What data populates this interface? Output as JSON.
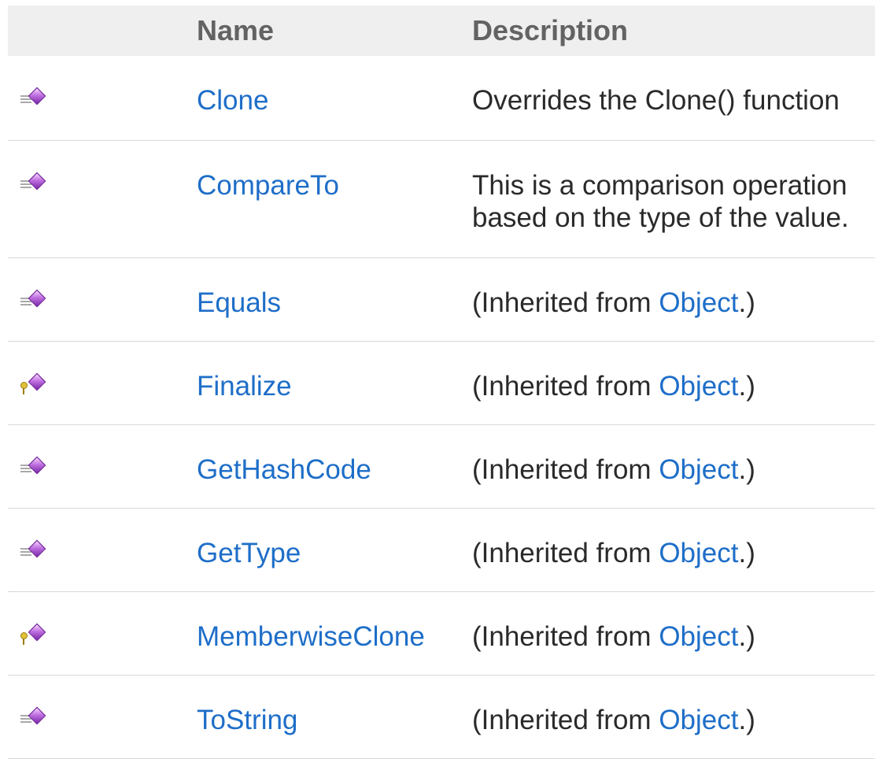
{
  "table": {
    "headers": {
      "icon": "",
      "name": "Name",
      "description": "Description"
    },
    "rows": [
      {
        "icon": "public-method-icon",
        "name": "Clone",
        "description": "Overrides the Clone() function"
      },
      {
        "icon": "public-method-icon",
        "name": "CompareTo",
        "description": "This is a comparison operation based on the type of the value."
      },
      {
        "icon": "public-method-icon",
        "name": "Equals",
        "inherited_prefix": "(Inherited from ",
        "inherited_link": "Object",
        "inherited_suffix": ".)"
      },
      {
        "icon": "protected-method-icon",
        "name": "Finalize",
        "inherited_prefix": "(Inherited from ",
        "inherited_link": "Object",
        "inherited_suffix": ".)"
      },
      {
        "icon": "public-method-icon",
        "name": "GetHashCode",
        "inherited_prefix": "(Inherited from ",
        "inherited_link": "Object",
        "inherited_suffix": ".)"
      },
      {
        "icon": "public-method-icon",
        "name": "GetType",
        "inherited_prefix": "(Inherited from ",
        "inherited_link": "Object",
        "inherited_suffix": ".)"
      },
      {
        "icon": "protected-method-icon",
        "name": "MemberwiseClone",
        "inherited_prefix": "(Inherited from ",
        "inherited_link": "Object",
        "inherited_suffix": ".)"
      },
      {
        "icon": "public-method-icon",
        "name": "ToString",
        "inherited_prefix": "(Inherited from ",
        "inherited_link": "Object",
        "inherited_suffix": ".)"
      }
    ]
  },
  "colors": {
    "link": "#1e6ec8",
    "header_bg": "#efefef",
    "header_text": "#636363",
    "text": "#2a2a2a",
    "row_border": "#d9d9d9"
  }
}
